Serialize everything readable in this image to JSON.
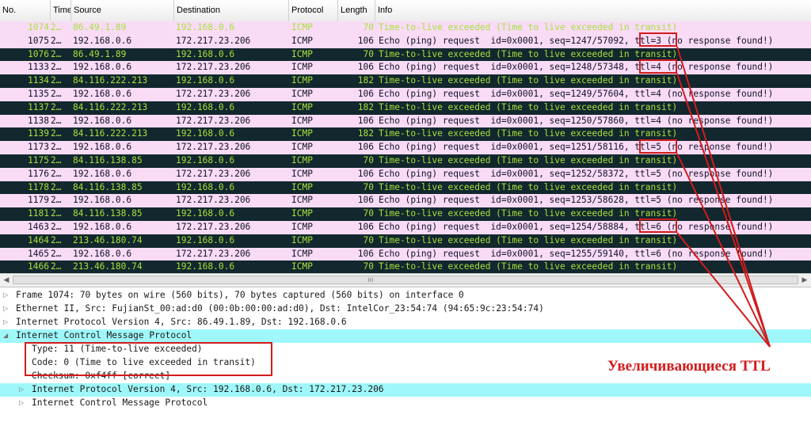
{
  "columns": {
    "no": "No.",
    "time": "Time",
    "source": "Source",
    "destination": "Destination",
    "protocol": "Protocol",
    "length": "Length",
    "info": "Info"
  },
  "packets": [
    {
      "no": "1074",
      "time": "2…",
      "src": "86.49.1.89",
      "dst": "192.168.0.6",
      "proto": "ICMP",
      "len": "70",
      "info": "Time-to-live exceeded (Time to live exceeded in transit)",
      "kind": "first"
    },
    {
      "no": "1075",
      "time": "2…",
      "src": "192.168.0.6",
      "dst": "172.217.23.206",
      "proto": "ICMP",
      "len": "106",
      "info": "Echo (ping) request  id=0x0001, seq=1247/57092, ttl=3 (no response found!)",
      "kind": "req"
    },
    {
      "no": "1076",
      "time": "2…",
      "src": "86.49.1.89",
      "dst": "192.168.0.6",
      "proto": "ICMP",
      "len": "70",
      "info": "Time-to-live exceeded (Time to live exceeded in transit)",
      "kind": "ttl"
    },
    {
      "no": "1133",
      "time": "2…",
      "src": "192.168.0.6",
      "dst": "172.217.23.206",
      "proto": "ICMP",
      "len": "106",
      "info": "Echo (ping) request  id=0x0001, seq=1248/57348, ttl=4 (no response found!)",
      "kind": "req"
    },
    {
      "no": "1134",
      "time": "2…",
      "src": "84.116.222.213",
      "dst": "192.168.0.6",
      "proto": "ICMP",
      "len": "182",
      "info": "Time-to-live exceeded (Time to live exceeded in transit)",
      "kind": "ttl"
    },
    {
      "no": "1135",
      "time": "2…",
      "src": "192.168.0.6",
      "dst": "172.217.23.206",
      "proto": "ICMP",
      "len": "106",
      "info": "Echo (ping) request  id=0x0001, seq=1249/57604, ttl=4 (no response found!)",
      "kind": "req"
    },
    {
      "no": "1137",
      "time": "2…",
      "src": "84.116.222.213",
      "dst": "192.168.0.6",
      "proto": "ICMP",
      "len": "182",
      "info": "Time-to-live exceeded (Time to live exceeded in transit)",
      "kind": "ttl"
    },
    {
      "no": "1138",
      "time": "2…",
      "src": "192.168.0.6",
      "dst": "172.217.23.206",
      "proto": "ICMP",
      "len": "106",
      "info": "Echo (ping) request  id=0x0001, seq=1250/57860, ttl=4 (no response found!)",
      "kind": "req"
    },
    {
      "no": "1139",
      "time": "2…",
      "src": "84.116.222.213",
      "dst": "192.168.0.6",
      "proto": "ICMP",
      "len": "182",
      "info": "Time-to-live exceeded (Time to live exceeded in transit)",
      "kind": "ttl"
    },
    {
      "no": "1173",
      "time": "2…",
      "src": "192.168.0.6",
      "dst": "172.217.23.206",
      "proto": "ICMP",
      "len": "106",
      "info": "Echo (ping) request  id=0x0001, seq=1251/58116, ttl=5 (no response found!)",
      "kind": "req"
    },
    {
      "no": "1175",
      "time": "2…",
      "src": "84.116.138.85",
      "dst": "192.168.0.6",
      "proto": "ICMP",
      "len": "70",
      "info": "Time-to-live exceeded (Time to live exceeded in transit)",
      "kind": "ttl"
    },
    {
      "no": "1176",
      "time": "2…",
      "src": "192.168.0.6",
      "dst": "172.217.23.206",
      "proto": "ICMP",
      "len": "106",
      "info": "Echo (ping) request  id=0x0001, seq=1252/58372, ttl=5 (no response found!)",
      "kind": "req"
    },
    {
      "no": "1178",
      "time": "2…",
      "src": "84.116.138.85",
      "dst": "192.168.0.6",
      "proto": "ICMP",
      "len": "70",
      "info": "Time-to-live exceeded (Time to live exceeded in transit)",
      "kind": "ttl"
    },
    {
      "no": "1179",
      "time": "2…",
      "src": "192.168.0.6",
      "dst": "172.217.23.206",
      "proto": "ICMP",
      "len": "106",
      "info": "Echo (ping) request  id=0x0001, seq=1253/58628, ttl=5 (no response found!)",
      "kind": "req"
    },
    {
      "no": "1181",
      "time": "2…",
      "src": "84.116.138.85",
      "dst": "192.168.0.6",
      "proto": "ICMP",
      "len": "70",
      "info": "Time-to-live exceeded (Time to live exceeded in transit)",
      "kind": "ttl"
    },
    {
      "no": "1463",
      "time": "2…",
      "src": "192.168.0.6",
      "dst": "172.217.23.206",
      "proto": "ICMP",
      "len": "106",
      "info": "Echo (ping) request  id=0x0001, seq=1254/58884, ttl=6 (no response found!)",
      "kind": "req"
    },
    {
      "no": "1464",
      "time": "2…",
      "src": "213.46.180.74",
      "dst": "192.168.0.6",
      "proto": "ICMP",
      "len": "70",
      "info": "Time-to-live exceeded (Time to live exceeded in transit)",
      "kind": "ttl"
    },
    {
      "no": "1465",
      "time": "2…",
      "src": "192.168.0.6",
      "dst": "172.217.23.206",
      "proto": "ICMP",
      "len": "106",
      "info": "Echo (ping) request  id=0x0001, seq=1255/59140, ttl=6 (no response found!)",
      "kind": "req"
    },
    {
      "no": "1466",
      "time": "2…",
      "src": "213.46.180.74",
      "dst": "192.168.0.6",
      "proto": "ICMP",
      "len": "70",
      "info": "Time-to-live exceeded (Time to live exceeded in transit)",
      "kind": "ttl"
    }
  ],
  "scrollbar": {
    "left_icon": "scroll-left-icon",
    "right_icon": "scroll-right-icon",
    "grip": "ııı"
  },
  "details": [
    {
      "text": "Frame 1074: 70 bytes on wire (560 bits), 70 bytes captured (560 bits) on interface 0",
      "level": 0,
      "expander": "collapsed"
    },
    {
      "text": "Ethernet II, Src: FujianSt_00:ad:d0 (00:0b:00:00:ad:d0), Dst: IntelCor_23:54:74 (94:65:9c:23:54:74)",
      "level": 0,
      "expander": "collapsed"
    },
    {
      "text": "Internet Protocol Version 4, Src: 86.49.1.89, Dst: 192.168.0.6",
      "level": 0,
      "expander": "collapsed"
    },
    {
      "text": "Internet Control Message Protocol",
      "level": 0,
      "expander": "expanded",
      "highlight": true
    },
    {
      "text": "Type: 11 (Time-to-live exceeded)",
      "level": 1,
      "expander": "none"
    },
    {
      "text": "Code: 0 (Time to live exceeded in transit)",
      "level": 1,
      "expander": "none"
    },
    {
      "text": "Checksum: 0xf4ff [correct]",
      "level": 1,
      "expander": "none"
    },
    {
      "text": "Internet Protocol Version 4, Src: 192.168.0.6, Dst: 172.217.23.206",
      "level": 1,
      "expander": "collapsed",
      "highlight": true
    },
    {
      "text": "Internet Control Message Protocol",
      "level": 1,
      "expander": "collapsed"
    }
  ],
  "annotation": {
    "label": "Увеличивающиеся TTL",
    "color": "#d31b1b"
  },
  "colors": {
    "request_bg": "#f9dbf6",
    "ttl_bg": "#12272e",
    "ttl_fg": "#a6e23a",
    "detail_highlight": "#9ff7fa"
  }
}
